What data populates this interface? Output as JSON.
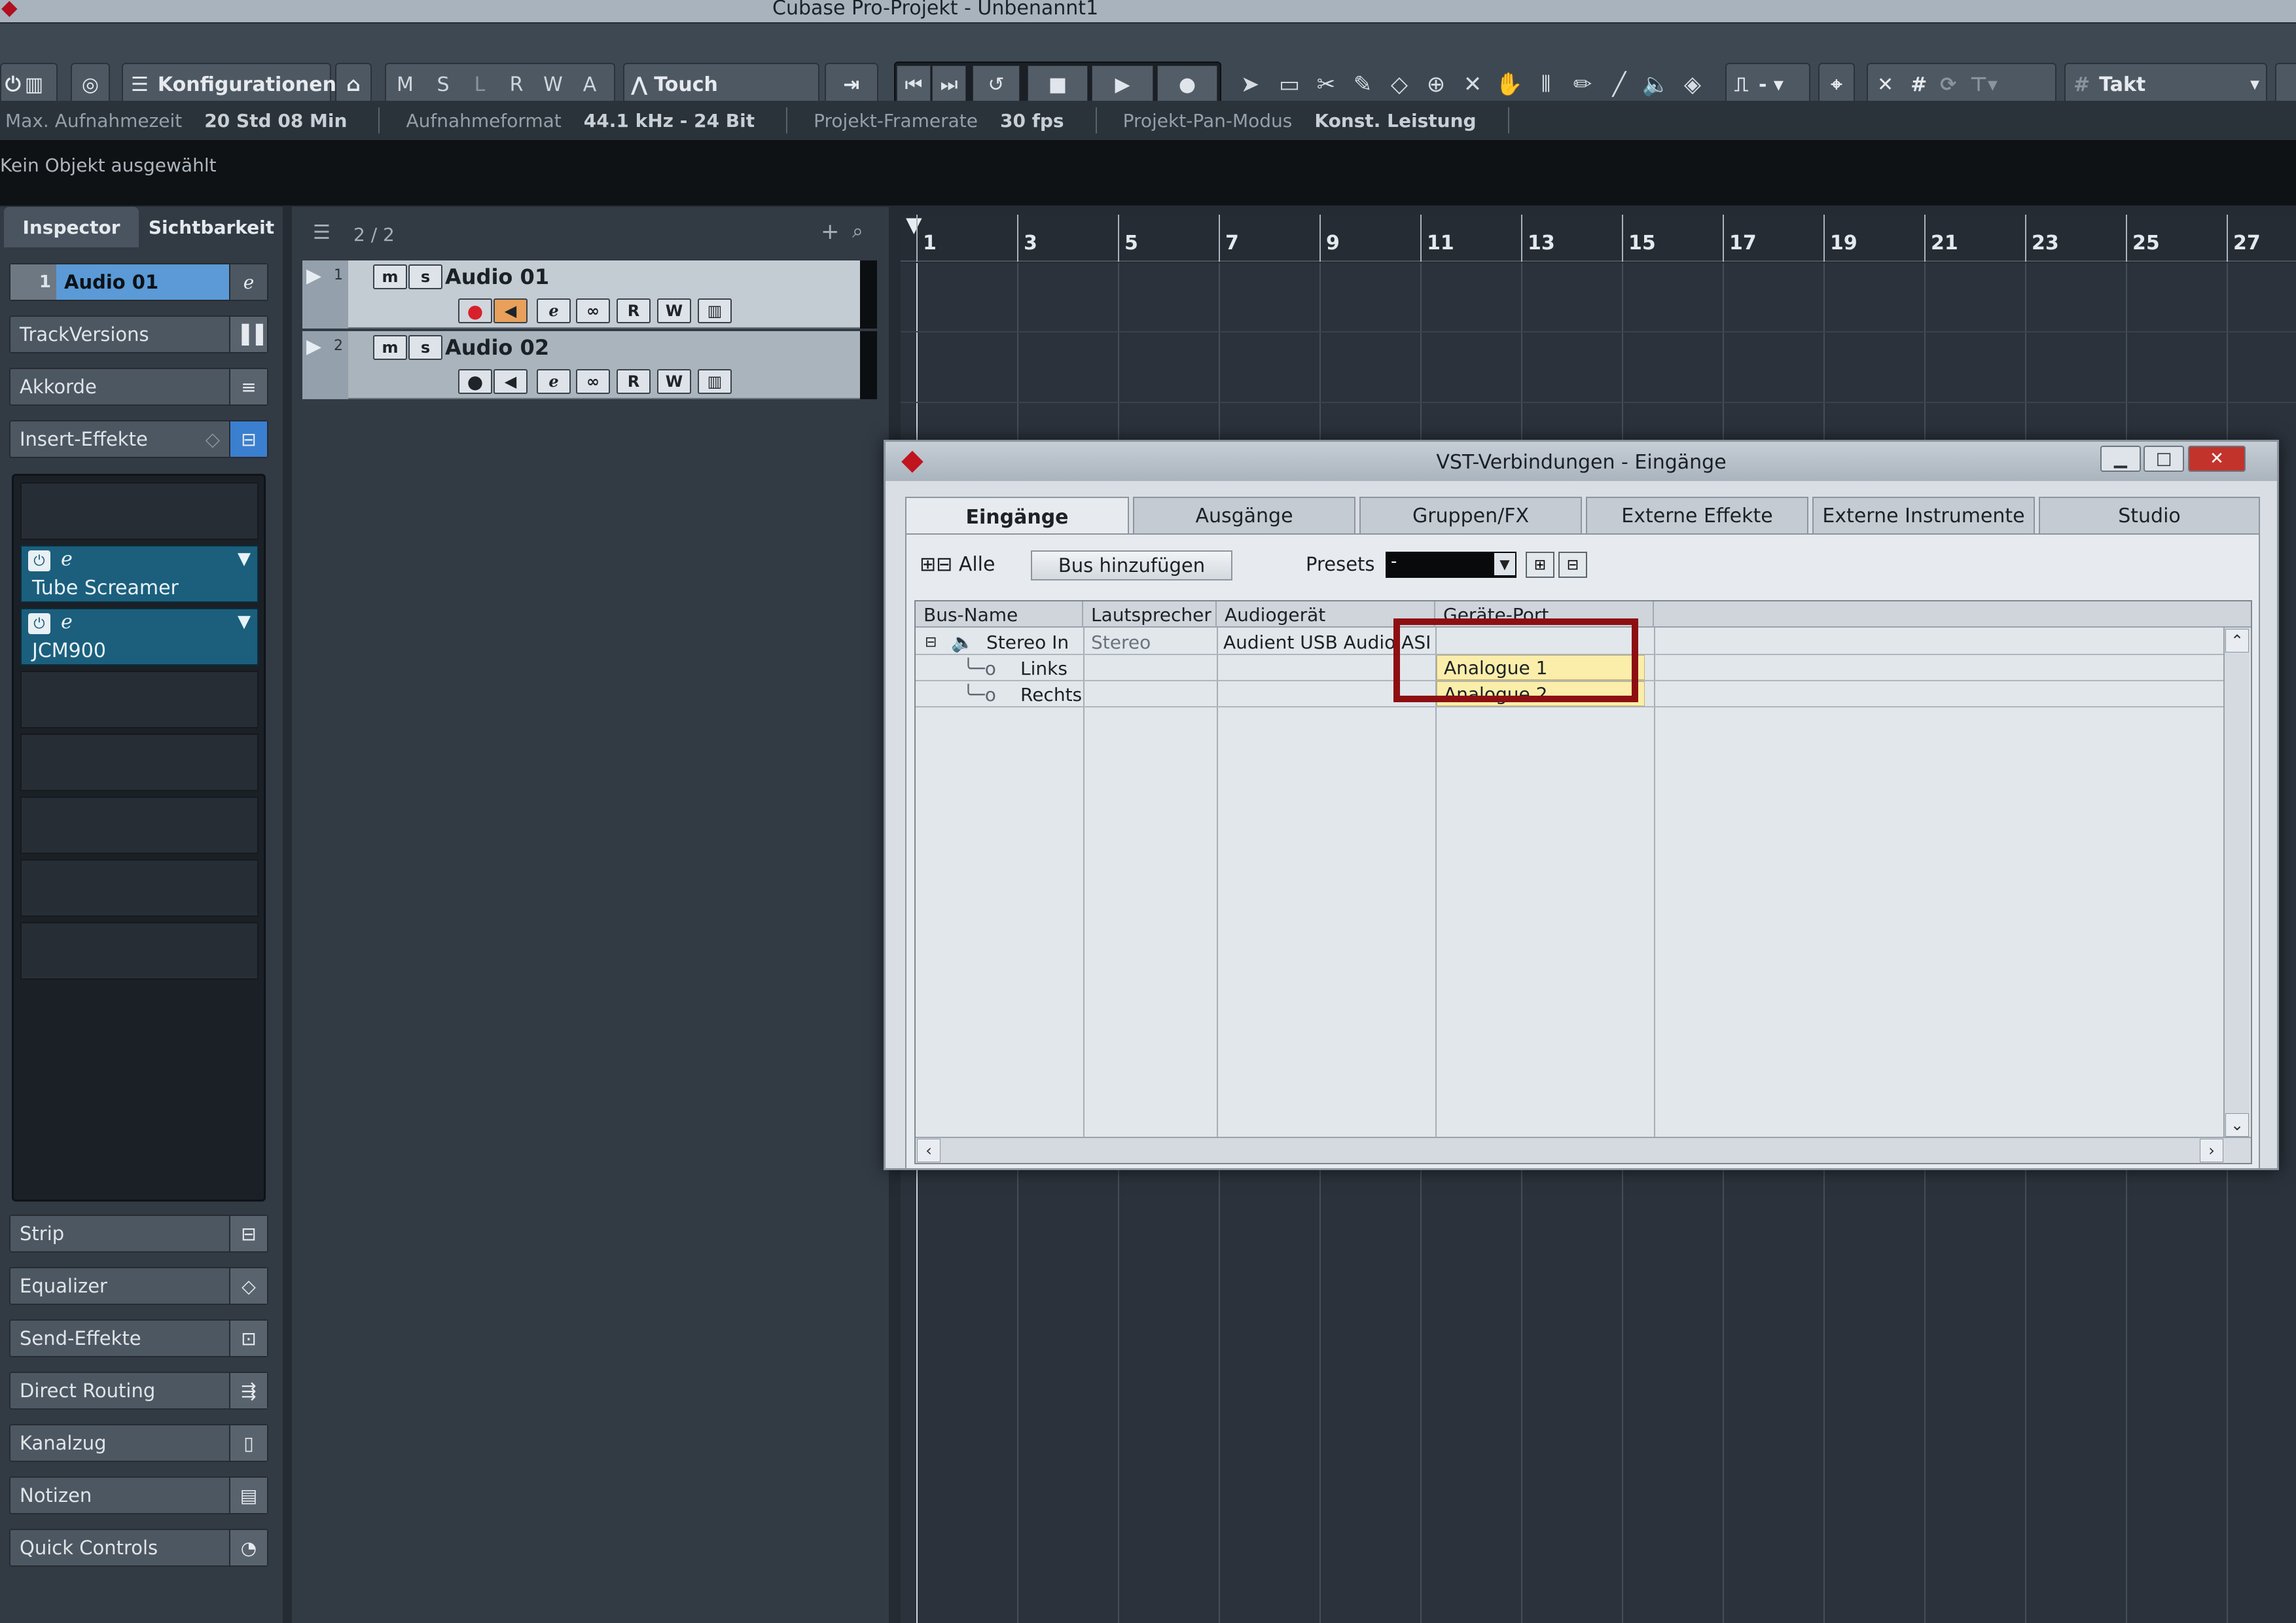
{
  "window": {
    "title": "Cubase Pro-Projekt - Unbenannt1"
  },
  "toolbar": {
    "config_label": "Konfigurationen",
    "mode_letters": [
      "M",
      "S",
      "L",
      "R",
      "W",
      "A"
    ],
    "automation_mode": "Touch",
    "grid_label": "Takt"
  },
  "status": {
    "max_rec_label": "Max. Aufnahmezeit",
    "max_rec_value": "20 Std 08 Min",
    "rec_format_label": "Aufnahmeformat",
    "rec_format_value": "44.1 kHz - 24 Bit",
    "framerate_label": "Projekt-Framerate",
    "framerate_value": "30 fps",
    "pan_label": "Projekt-Pan-Modus",
    "pan_value": "Konst. Leistung"
  },
  "info_line": "Kein Objekt ausgewählt",
  "inspector": {
    "tabs": [
      "Inspector",
      "Sichtbarkeit"
    ],
    "track_num": "1",
    "track_name": "Audio 01",
    "sections_top": [
      "TrackVersions",
      "Akkorde",
      "Insert-Effekte"
    ],
    "inserts": [
      "Tube Screamer",
      "JCM900"
    ],
    "sections_bottom": [
      "Strip",
      "Equalizer",
      "Send-Effekte",
      "Direct Routing",
      "Kanalzug",
      "Notizen",
      "Quick Controls"
    ]
  },
  "tracklist": {
    "count": "2 / 2",
    "tracks": [
      {
        "num": "1",
        "name": "Audio 01"
      },
      {
        "num": "2",
        "name": "Audio 02"
      }
    ],
    "btn_m": "m",
    "btn_s": "s",
    "btn_r": "R",
    "btn_w": "W"
  },
  "ruler": {
    "bars": [
      "1",
      "3",
      "5",
      "7",
      "9",
      "11",
      "13",
      "15",
      "17",
      "19",
      "21",
      "23",
      "25",
      "27"
    ]
  },
  "vst": {
    "title": "VST-Verbindungen - Eingänge",
    "tabs": [
      "Eingänge",
      "Ausgänge",
      "Gruppen/FX",
      "Externe Effekte",
      "Externe Instrumente",
      "Studio"
    ],
    "alle": "Alle",
    "add_bus": "Bus hinzufügen",
    "presets_label": "Presets",
    "presets_value": "-",
    "columns": [
      "Bus-Name",
      "Lautsprecher",
      "Audiogerät",
      "Geräte-Port"
    ],
    "bus": {
      "name": "Stereo In",
      "speaker": "Stereo",
      "device": "Audient USB Audio ASIO"
    },
    "channels": [
      {
        "name": "Links",
        "port": "Analogue 1"
      },
      {
        "name": "Rechts",
        "port": "Analogue 2"
      }
    ],
    "colors": {
      "highlight": "#8e0f12",
      "port_bg": "#fbeeaa"
    }
  },
  "colors": {
    "accent_red": "#c0141f",
    "insert_blue": "#1b5f7d",
    "bg": "#252b33"
  }
}
